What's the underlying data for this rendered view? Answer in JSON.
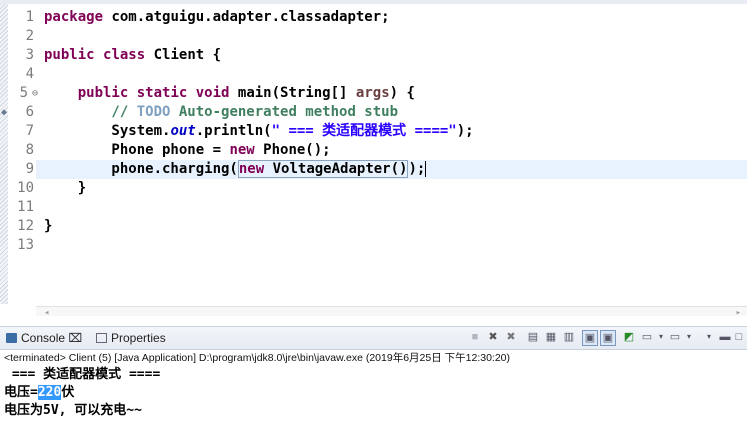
{
  "editor": {
    "line_numbers": [
      "1",
      "2",
      "3",
      "4",
      "5",
      "6",
      "7",
      "8",
      "9",
      "10",
      "11",
      "12",
      "13"
    ],
    "code": {
      "l1_kw": "package",
      "l1_rest": " com.atguigu.adapter.classadapter;",
      "l3_kw1": "public",
      "l3_kw2": "class",
      "l3_rest": " Client {",
      "l5_indent": "    ",
      "l5_kw1": "public",
      "l5_kw2": "static",
      "l5_kw3": "void",
      "l5_rest1": " main(String[] ",
      "l5_var": "args",
      "l5_rest2": ") {",
      "l6_comment_start": "        // ",
      "l6_todo": "TODO",
      "l6_comment_end": " Auto-generated method stub",
      "l7_a": "        System.",
      "l7_field": "out",
      "l7_b": ".println(",
      "l7_str": "\" === 类适配器模式 ====\"",
      "l7_c": ");",
      "l8_a": "        Phone phone = ",
      "l8_kw": "new",
      "l8_b": " Phone();",
      "l9_a": "        phone.charging(",
      "l9_kw": "new",
      "l9_b": " VoltageAdapter()",
      "l9_c": ");",
      "l10": "    }",
      "l12": "}"
    }
  },
  "console_view": {
    "tab_console": "Console ⌧",
    "tab_properties": "Properties",
    "status": "<terminated> Client (5) [Java Application] D:\\program\\jdk8.0\\jre\\bin\\javaw.exe (2019年6月25日 下午12:30:20)",
    "output": {
      "line1": " === 类适配器模式 ====",
      "line2_a": "电压=",
      "line2_sel": "220",
      "line2_b": "伏",
      "line3": "电压为5V, 可以充电~~"
    }
  }
}
